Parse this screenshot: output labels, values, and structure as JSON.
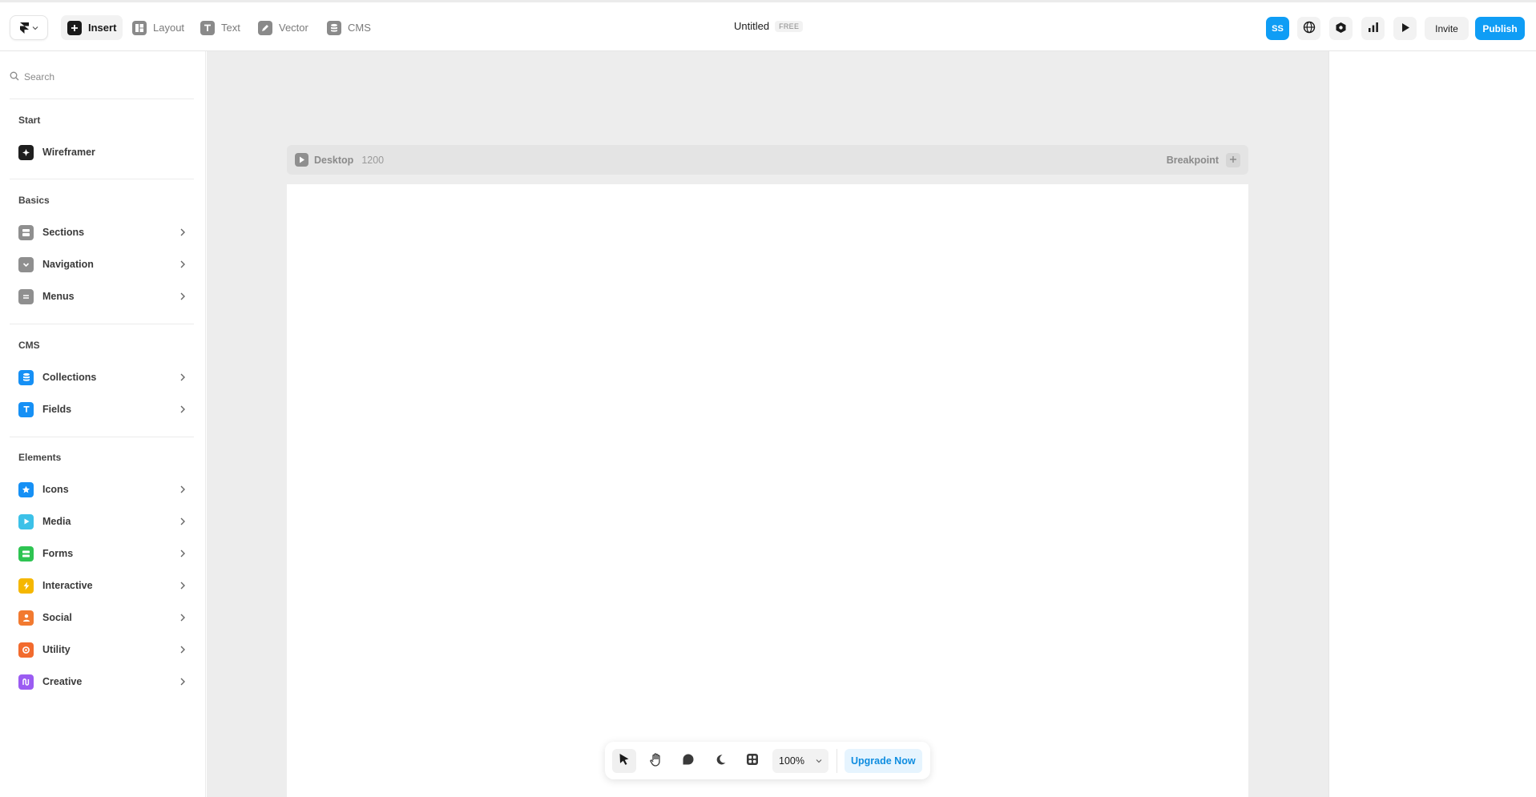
{
  "topbar": {
    "logo_icon": "framer-logo-icon",
    "tabs": [
      {
        "label": "Insert",
        "icon": "plus-square-icon",
        "active": true
      },
      {
        "label": "Layout",
        "icon": "layout-icon",
        "active": false
      },
      {
        "label": "Text",
        "icon": "text-icon",
        "active": false
      },
      {
        "label": "Vector",
        "icon": "pen-icon",
        "active": false
      },
      {
        "label": "CMS",
        "icon": "database-icon",
        "active": false
      }
    ],
    "doc_title": "Untitled",
    "plan_badge": "FREE",
    "avatar_initials": "SS",
    "icons": [
      "globe-icon",
      "settings-hex-icon",
      "analytics-icon",
      "play-icon"
    ],
    "invite_label": "Invite",
    "publish_label": "Publish",
    "accent_color": "#0f9df5"
  },
  "sidebar": {
    "search_placeholder": "Search",
    "sections": [
      {
        "title": "Start",
        "items": [
          {
            "label": "Wireframer",
            "icon": "wireframer-icon",
            "color": "#1f1f1f",
            "has_chevron": false
          }
        ]
      },
      {
        "title": "Basics",
        "items": [
          {
            "label": "Sections",
            "icon": "sections-icon",
            "color": "#8f8f8f",
            "has_chevron": true
          },
          {
            "label": "Navigation",
            "icon": "navigation-icon",
            "color": "#8f8f8f",
            "has_chevron": true
          },
          {
            "label": "Menus",
            "icon": "menus-icon",
            "color": "#8f8f8f",
            "has_chevron": true
          }
        ]
      },
      {
        "title": "CMS",
        "items": [
          {
            "label": "Collections",
            "icon": "collections-icon",
            "color": "#1690f5",
            "has_chevron": true
          },
          {
            "label": "Fields",
            "icon": "fields-icon",
            "color": "#1690f5",
            "has_chevron": true
          }
        ]
      },
      {
        "title": "Elements",
        "items": [
          {
            "label": "Icons",
            "icon": "star-icon",
            "color": "#1690f5",
            "has_chevron": true
          },
          {
            "label": "Media",
            "icon": "media-play-icon",
            "color": "#3cc1e8",
            "has_chevron": true
          },
          {
            "label": "Forms",
            "icon": "forms-icon",
            "color": "#2ec452",
            "has_chevron": true
          },
          {
            "label": "Interactive",
            "icon": "lightning-icon",
            "color": "#f5b700",
            "has_chevron": true
          },
          {
            "label": "Social",
            "icon": "person-icon",
            "color": "#f27a30",
            "has_chevron": true
          },
          {
            "label": "Utility",
            "icon": "target-icon",
            "color": "#f26b2e",
            "has_chevron": true
          },
          {
            "label": "Creative",
            "icon": "creative-icon",
            "color": "#9b5cf2",
            "has_chevron": true
          }
        ]
      }
    ]
  },
  "canvas": {
    "frame_name": "Desktop",
    "frame_width": "1200",
    "breakpoint_label": "Breakpoint"
  },
  "bottombar": {
    "tools": [
      "pointer-icon",
      "hand-icon",
      "comment-icon",
      "moon-icon",
      "grid-apps-icon"
    ],
    "zoom": "100%",
    "upgrade_label": "Upgrade Now"
  }
}
